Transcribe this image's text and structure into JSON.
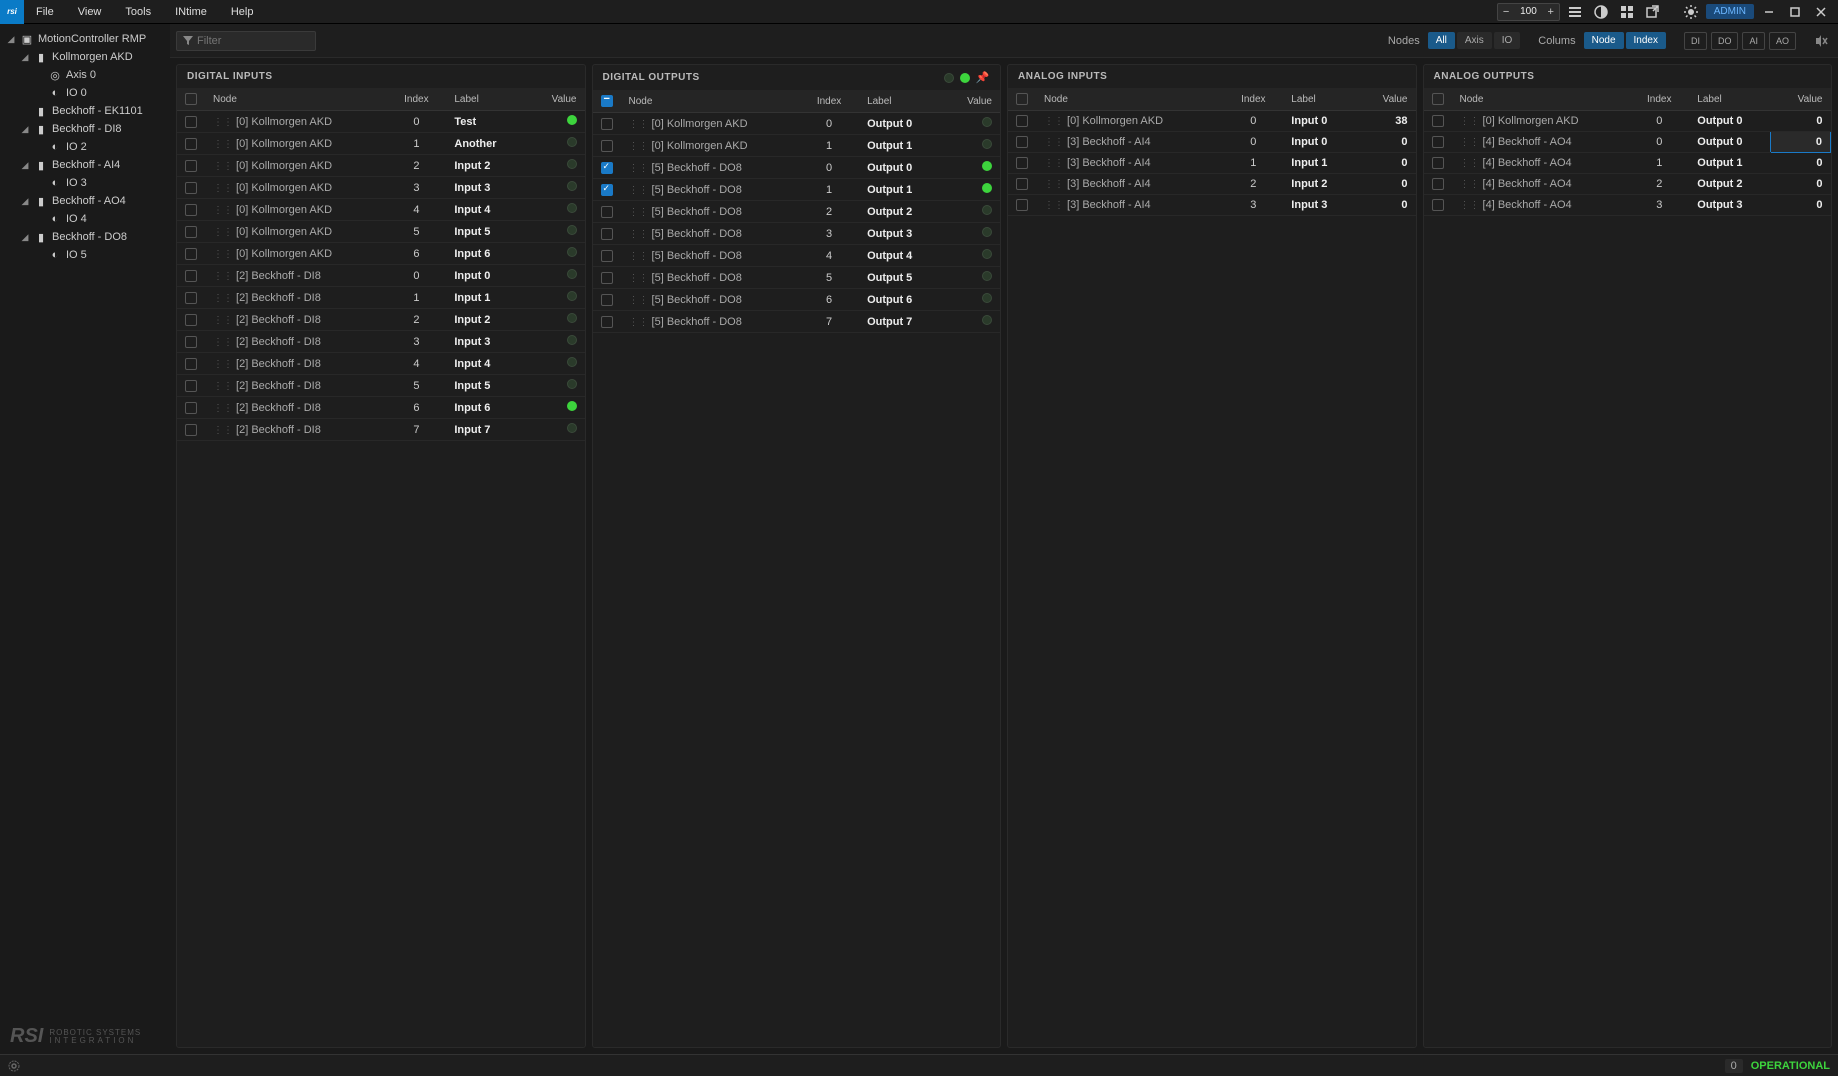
{
  "menu": [
    "File",
    "View",
    "Tools",
    "INtime",
    "Help"
  ],
  "zoom": "100",
  "admin_label": "ADMIN",
  "filter_placeholder": "Filter",
  "nodes_label": "Nodes",
  "nodes_tabs": [
    "All",
    "Axis",
    "IO"
  ],
  "cols_label": "Colums",
  "cols_tabs": [
    "Node",
    "Index"
  ],
  "sq_btns": [
    "DI",
    "DO",
    "AI",
    "AO"
  ],
  "tree": [
    {
      "level": 0,
      "caret": true,
      "icon": "chip",
      "label": "MotionController RMP"
    },
    {
      "level": 1,
      "caret": true,
      "icon": "drive",
      "label": "Kollmorgen AKD"
    },
    {
      "level": 2,
      "caret": false,
      "icon": "target",
      "label": "Axis 0"
    },
    {
      "level": 2,
      "caret": false,
      "icon": "half",
      "label": "IO 0"
    },
    {
      "level": 1,
      "caret": false,
      "icon": "drive",
      "label": "Beckhoff - EK1101"
    },
    {
      "level": 1,
      "caret": true,
      "icon": "drive",
      "label": "Beckhoff - DI8"
    },
    {
      "level": 2,
      "caret": false,
      "icon": "half",
      "label": "IO 2"
    },
    {
      "level": 1,
      "caret": true,
      "icon": "drive",
      "label": "Beckhoff - AI4"
    },
    {
      "level": 2,
      "caret": false,
      "icon": "half",
      "label": "IO 3"
    },
    {
      "level": 1,
      "caret": true,
      "icon": "drive",
      "label": "Beckhoff - AO4"
    },
    {
      "level": 2,
      "caret": false,
      "icon": "half",
      "label": "IO 4"
    },
    {
      "level": 1,
      "caret": true,
      "icon": "drive",
      "label": "Beckhoff - DO8"
    },
    {
      "level": 2,
      "caret": false,
      "icon": "half",
      "label": "IO 5"
    }
  ],
  "panels": {
    "di": {
      "title": "DIGITAL INPUTS",
      "cols": [
        "Node",
        "Index",
        "Label",
        "Value"
      ],
      "rows": [
        {
          "node": "[0] Kollmorgen AKD",
          "idx": "0",
          "label": "Test",
          "on": true
        },
        {
          "node": "[0] Kollmorgen AKD",
          "idx": "1",
          "label": "Another",
          "on": false
        },
        {
          "node": "[0] Kollmorgen AKD",
          "idx": "2",
          "label": "Input 2",
          "on": false
        },
        {
          "node": "[0] Kollmorgen AKD",
          "idx": "3",
          "label": "Input 3",
          "on": false
        },
        {
          "node": "[0] Kollmorgen AKD",
          "idx": "4",
          "label": "Input 4",
          "on": false
        },
        {
          "node": "[0] Kollmorgen AKD",
          "idx": "5",
          "label": "Input 5",
          "on": false
        },
        {
          "node": "[0] Kollmorgen AKD",
          "idx": "6",
          "label": "Input 6",
          "on": false
        },
        {
          "node": "[2] Beckhoff - DI8",
          "idx": "0",
          "label": "Input 0",
          "on": false
        },
        {
          "node": "[2] Beckhoff - DI8",
          "idx": "1",
          "label": "Input 1",
          "on": false
        },
        {
          "node": "[2] Beckhoff - DI8",
          "idx": "2",
          "label": "Input 2",
          "on": false
        },
        {
          "node": "[2] Beckhoff - DI8",
          "idx": "3",
          "label": "Input 3",
          "on": false
        },
        {
          "node": "[2] Beckhoff - DI8",
          "idx": "4",
          "label": "Input 4",
          "on": false
        },
        {
          "node": "[2] Beckhoff - DI8",
          "idx": "5",
          "label": "Input 5",
          "on": false
        },
        {
          "node": "[2] Beckhoff - DI8",
          "idx": "6",
          "label": "Input 6",
          "on": true
        },
        {
          "node": "[2] Beckhoff - DI8",
          "idx": "7",
          "label": "Input 7",
          "on": false
        }
      ]
    },
    "do": {
      "title": "DIGITAL OUTPUTS",
      "cols": [
        "Node",
        "Index",
        "Label",
        "Value"
      ],
      "rows": [
        {
          "chk": false,
          "node": "[0] Kollmorgen AKD",
          "idx": "0",
          "label": "Output 0",
          "on": false
        },
        {
          "chk": false,
          "node": "[0] Kollmorgen AKD",
          "idx": "1",
          "label": "Output 1",
          "on": false
        },
        {
          "chk": true,
          "node": "[5] Beckhoff - DO8",
          "idx": "0",
          "label": "Output 0",
          "on": true
        },
        {
          "chk": true,
          "node": "[5] Beckhoff - DO8",
          "idx": "1",
          "label": "Output 1",
          "on": true
        },
        {
          "chk": false,
          "node": "[5] Beckhoff - DO8",
          "idx": "2",
          "label": "Output 2",
          "on": false
        },
        {
          "chk": false,
          "node": "[5] Beckhoff - DO8",
          "idx": "3",
          "label": "Output 3",
          "on": false
        },
        {
          "chk": false,
          "node": "[5] Beckhoff - DO8",
          "idx": "4",
          "label": "Output 4",
          "on": false
        },
        {
          "chk": false,
          "node": "[5] Beckhoff - DO8",
          "idx": "5",
          "label": "Output 5",
          "on": false
        },
        {
          "chk": false,
          "node": "[5] Beckhoff - DO8",
          "idx": "6",
          "label": "Output 6",
          "on": false
        },
        {
          "chk": false,
          "node": "[5] Beckhoff - DO8",
          "idx": "7",
          "label": "Output 7",
          "on": false
        }
      ]
    },
    "ai": {
      "title": "ANALOG INPUTS",
      "cols": [
        "Node",
        "Index",
        "Label",
        "Value"
      ],
      "rows": [
        {
          "node": "[0] Kollmorgen AKD",
          "idx": "0",
          "label": "Input 0",
          "val": "38"
        },
        {
          "node": "[3] Beckhoff - AI4",
          "idx": "0",
          "label": "Input 0",
          "val": "0"
        },
        {
          "node": "[3] Beckhoff - AI4",
          "idx": "1",
          "label": "Input 1",
          "val": "0"
        },
        {
          "node": "[3] Beckhoff - AI4",
          "idx": "2",
          "label": "Input 2",
          "val": "0"
        },
        {
          "node": "[3] Beckhoff - AI4",
          "idx": "3",
          "label": "Input 3",
          "val": "0"
        }
      ]
    },
    "ao": {
      "title": "ANALOG OUTPUTS",
      "cols": [
        "Node",
        "Index",
        "Label",
        "Value"
      ],
      "rows": [
        {
          "node": "[0] Kollmorgen AKD",
          "idx": "0",
          "label": "Output 0",
          "val": "0",
          "edit": false
        },
        {
          "node": "[4] Beckhoff - AO4",
          "idx": "0",
          "label": "Output 0",
          "val": "0",
          "edit": true
        },
        {
          "node": "[4] Beckhoff - AO4",
          "idx": "1",
          "label": "Output 1",
          "val": "0",
          "edit": false
        },
        {
          "node": "[4] Beckhoff - AO4",
          "idx": "2",
          "label": "Output 2",
          "val": "0",
          "edit": false
        },
        {
          "node": "[4] Beckhoff - AO4",
          "idx": "3",
          "label": "Output 3",
          "val": "0",
          "edit": false
        }
      ]
    }
  },
  "footer_brand": "RSI",
  "footer_sub1": "ROBOTIC SYSTEMS",
  "footer_sub2": "INTEGRATION",
  "status_count": "0",
  "status_text": "OPERATIONAL"
}
